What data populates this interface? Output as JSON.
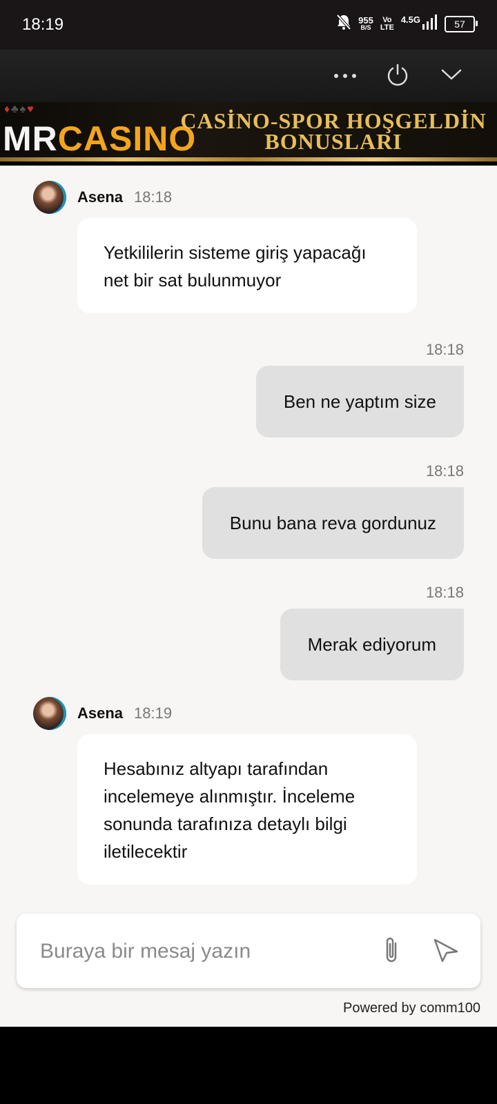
{
  "status_bar": {
    "time": "18:19",
    "net_speed_value": "955",
    "net_speed_unit": "B/S",
    "volte_top": "Vo",
    "volte_bottom": "LTE",
    "network": "4.5G",
    "battery": "57"
  },
  "banner": {
    "logo_mr": "MR",
    "logo_casino": "CASINO",
    "headline_line1": "CASİNO-SPOR HOŞGELDİN",
    "headline_line2": "BONUSLARI"
  },
  "messages": [
    {
      "type": "agent",
      "name": "Asena",
      "time": "18:18",
      "text": "Yetkililerin sisteme giriş yapacağı net bir sat bulunmuyor"
    },
    {
      "type": "visitor",
      "time": "18:18",
      "text": "Ben ne yaptım size"
    },
    {
      "type": "visitor",
      "time": "18:18",
      "text": "Bunu bana reva gordunuz"
    },
    {
      "type": "visitor",
      "time": "18:18",
      "text": "Merak ediyorum"
    },
    {
      "type": "agent",
      "name": "Asena",
      "time": "18:19",
      "text": "Hesabınız altyapı tarafından incelemeye alınmıştır. İnceleme sonunda tarafınıza detaylı bilgi iletilecektir"
    }
  ],
  "composer": {
    "placeholder": "Buraya bir mesaj yazın"
  },
  "footer": {
    "powered_by": "Powered by comm100"
  },
  "colors": {
    "accent_gold": "#e6be58",
    "logo_orange": "#f3a51e",
    "visitor_bubble": "#e0e0e0",
    "chat_bg": "#f7f6f4"
  }
}
